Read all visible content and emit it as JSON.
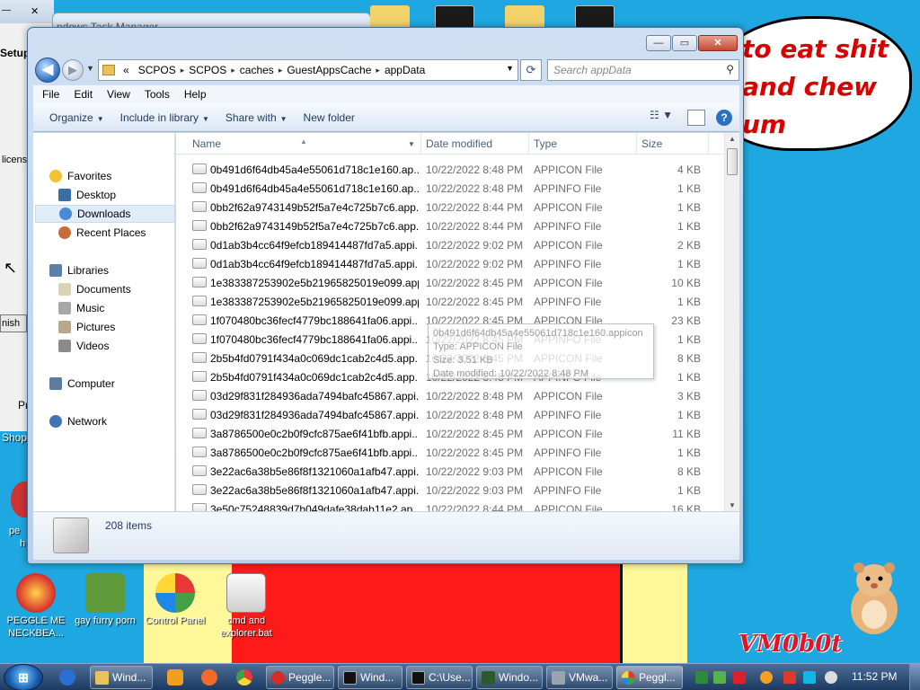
{
  "desktop": {
    "speech_lines": [
      "to eat shit",
      "and chew",
      "um"
    ],
    "logo_text": "VM0b0t",
    "icons": [
      {
        "label": "PEGGLE ME NECKBEA...",
        "color": "#d62b2b"
      },
      {
        "label": "gay furry porn",
        "color": "#5f9b3a"
      },
      {
        "label": "Control Panel",
        "color": "#f4f4f4"
      },
      {
        "label": "cmd and explorer.bat",
        "color": "#e6e6e6"
      }
    ],
    "background_labels": {
      "setup": "Setup",
      "license": "licens",
      "task_manager": "ndows Task Manager",
      "finish": "nish",
      "pr": "Pr",
      "shop": "Shop",
      "pe": "pe",
      "h": "h"
    }
  },
  "window": {
    "caption_buttons": {
      "min": "—",
      "max": "▭",
      "close": "✕"
    },
    "nav": {
      "back": "◀",
      "forward": "▶",
      "history": "▼"
    },
    "address": {
      "chevron": "«",
      "crumbs": [
        "SCPOS",
        "SCPOS",
        "caches",
        "GuestAppsCache",
        "appData"
      ],
      "separator": "▸"
    },
    "search_placeholder": "Search appData",
    "menu": [
      "File",
      "Edit",
      "View",
      "Tools",
      "Help"
    ],
    "commands": [
      "Organize",
      "Include in library",
      "Share with",
      "New folder"
    ],
    "nav_pane": {
      "favorites": "Favorites",
      "favorites_items": [
        "Desktop",
        "Downloads",
        "Recent Places"
      ],
      "libraries": "Libraries",
      "libraries_items": [
        "Documents",
        "Music",
        "Pictures",
        "Videos"
      ],
      "computer": "Computer",
      "network": "Network"
    },
    "columns": {
      "name": "Name",
      "date": "Date modified",
      "type": "Type",
      "size": "Size"
    },
    "files": [
      {
        "name": "0b491d6f64db45a4e55061d718c1e160.ap...",
        "date": "10/22/2022 8:48 PM",
        "type": "APPICON File",
        "size": "4 KB"
      },
      {
        "name": "0b491d6f64db45a4e55061d718c1e160.ap...",
        "date": "10/22/2022 8:48 PM",
        "type": "APPINFO File",
        "size": "1 KB"
      },
      {
        "name": "0bb2f62a9743149b52f5a7e4c725b7c6.app...",
        "date": "10/22/2022 8:44 PM",
        "type": "APPICON File",
        "size": "1 KB"
      },
      {
        "name": "0bb2f62a9743149b52f5a7e4c725b7c6.app...",
        "date": "10/22/2022 8:44 PM",
        "type": "APPINFO File",
        "size": "1 KB"
      },
      {
        "name": "0d1ab3b4cc64f9efcb189414487fd7a5.appi...",
        "date": "10/22/2022 9:02 PM",
        "type": "APPICON File",
        "size": "2 KB"
      },
      {
        "name": "0d1ab3b4cc64f9efcb189414487fd7a5.appi...",
        "date": "10/22/2022 9:02 PM",
        "type": "APPINFO File",
        "size": "1 KB"
      },
      {
        "name": "1e383387253902e5b21965825019e099.app...",
        "date": "10/22/2022 8:45 PM",
        "type": "APPICON File",
        "size": "10 KB"
      },
      {
        "name": "1e383387253902e5b21965825019e099.app...",
        "date": "10/22/2022 8:45 PM",
        "type": "APPINFO File",
        "size": "1 KB"
      },
      {
        "name": "1f070480bc36fecf4779bc188641fa06.appi...",
        "date": "10/22/2022 8:45 PM",
        "type": "APPICON File",
        "size": "23 KB"
      },
      {
        "name": "1f070480bc36fecf4779bc188641fa06.appi...",
        "date": "10/22/2022 8:45 PM",
        "type": "APPINFO File",
        "size": "1 KB"
      },
      {
        "name": "2b5b4fd0791f434a0c069dc1cab2c4d5.app...",
        "date": "10/22/2022 8:45 PM",
        "type": "APPICON File",
        "size": "8 KB"
      },
      {
        "name": "2b5b4fd0791f434a0c069dc1cab2c4d5.app...",
        "date": "10/22/2022 8:45 PM",
        "type": "APPINFO File",
        "size": "1 KB"
      },
      {
        "name": "03d29f831f284936ada7494bafc45867.appi...",
        "date": "10/22/2022 8:48 PM",
        "type": "APPICON File",
        "size": "3 KB"
      },
      {
        "name": "03d29f831f284936ada7494bafc45867.appi...",
        "date": "10/22/2022 8:48 PM",
        "type": "APPINFO File",
        "size": "1 KB"
      },
      {
        "name": "3a8786500e0c2b0f9cfc875ae6f41bfb.appi...",
        "date": "10/22/2022 8:45 PM",
        "type": "APPICON File",
        "size": "11 KB"
      },
      {
        "name": "3a8786500e0c2b0f9cfc875ae6f41bfb.appi...",
        "date": "10/22/2022 8:45 PM",
        "type": "APPINFO File",
        "size": "1 KB"
      },
      {
        "name": "3e22ac6a38b5e86f8f1321060a1afb47.appi...",
        "date": "10/22/2022 9:03 PM",
        "type": "APPICON File",
        "size": "8 KB"
      },
      {
        "name": "3e22ac6a38b5e86f8f1321060a1afb47.appi...",
        "date": "10/22/2022 9:03 PM",
        "type": "APPINFO File",
        "size": "1 KB"
      },
      {
        "name": "3e50c75248839d7b049dafe38dab11e2.ap...",
        "date": "10/22/2022 8:44 PM",
        "type": "APPICON File",
        "size": "16 KB"
      }
    ],
    "tooltip_lines": [
      "0b491d6f64db45a4e55061d718c1e160.appicon",
      "Type: APPICON File",
      "Size: 3.51 KB",
      "Date modified: 10/22/2022 8:48 PM"
    ],
    "item_count": "208 items"
  },
  "taskbar": {
    "start": "⊞",
    "buttons": [
      "Wind...",
      "Peggle...",
      "Wind...",
      "C:\\Use...",
      "Windo...",
      "VMwa...",
      "Peggl..."
    ],
    "clock": "11:52 PM"
  },
  "colors": {
    "desktop": "#1ea7e0",
    "accent": "#2f6fc0",
    "speech_text": "#d80000"
  }
}
